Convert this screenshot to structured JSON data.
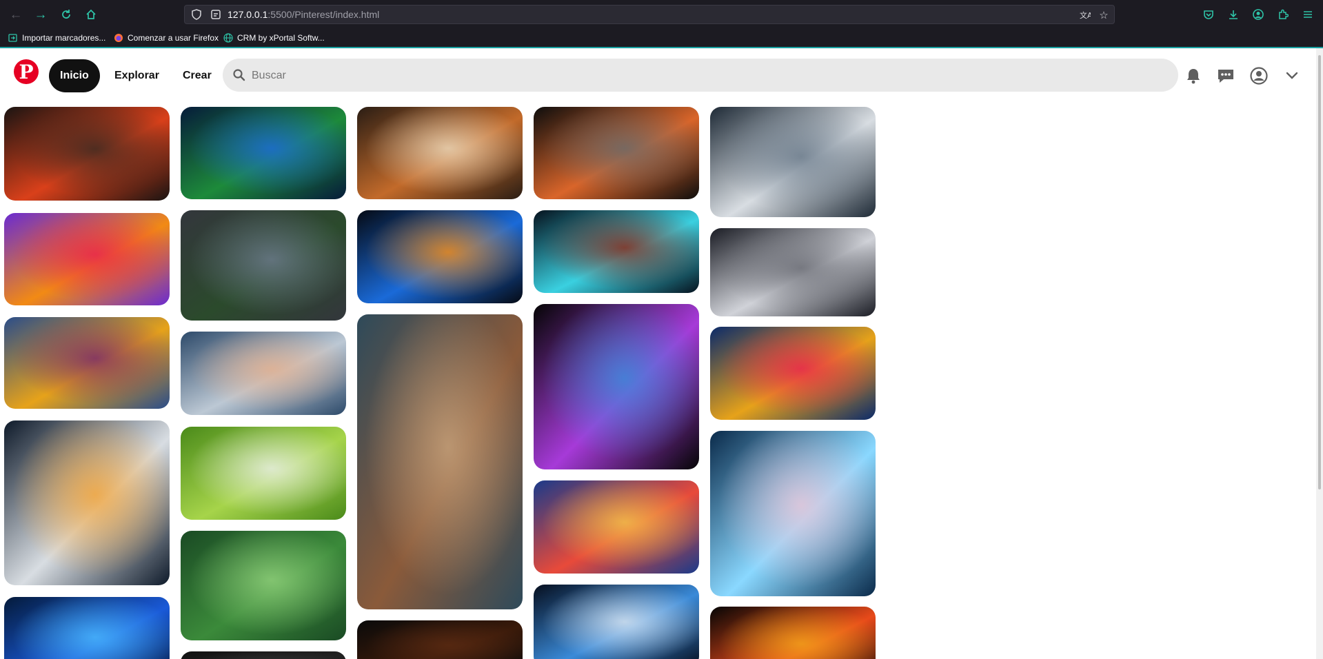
{
  "browser": {
    "url_host": "127.0.0.1",
    "url_path": ":5500/Pinterest/index.html",
    "bookmarks": [
      {
        "label": "Importar marcadores...",
        "icon": "import-icon"
      },
      {
        "label": "Comenzar a usar Firefox",
        "icon": "firefox-icon"
      },
      {
        "label": "CRM by xPortal Softw...",
        "icon": "globe-icon"
      }
    ]
  },
  "header": {
    "logo_letter": "P",
    "nav": {
      "home": "Inicio",
      "explore": "Explorar",
      "create": "Crear"
    },
    "search_placeholder": "Buscar"
  },
  "pins": [
    {
      "subject": "autumn-leaf",
      "colors": [
        "#1a1412",
        "#d9401a",
        "#3a2a22"
      ]
    },
    {
      "subject": "colorful-smoke",
      "colors": [
        "#6a2bd1",
        "#f28a14",
        "#e8234f"
      ]
    },
    {
      "subject": "cat-in-fantasy-forest",
      "colors": [
        "#2a4d8a",
        "#e6a21a",
        "#7a2a6a"
      ]
    },
    {
      "subject": "robot-lightbulb",
      "colors": [
        "#0e1a2a",
        "#d8dde2",
        "#f3a53a"
      ]
    },
    {
      "subject": "blue-lights",
      "colors": [
        "#041a3a",
        "#1a5ad8",
        "#4ab8ff"
      ]
    },
    {
      "subject": "tree-on-circuit-board",
      "colors": [
        "#061b3a",
        "#1d8a3a",
        "#1c6ad8"
      ]
    },
    {
      "subject": "child-and-plant",
      "colors": [
        "#33363c",
        "#2b4a2c",
        "#6b7a8a"
      ]
    },
    {
      "subject": "robot-handshake",
      "colors": [
        "#2d4a6a",
        "#bcc8d4",
        "#e3b08f"
      ]
    },
    {
      "subject": "robot-hand-daisy",
      "colors": [
        "#4a8a1a",
        "#a6d44a",
        "#e8eee4"
      ]
    },
    {
      "subject": "water-drops-leaves",
      "colors": [
        "#1a4a24",
        "#3b8a3a",
        "#8fcf7a"
      ]
    },
    {
      "subject": "dark-pin",
      "colors": [
        "#111111",
        "#222222",
        "#333333"
      ]
    },
    {
      "subject": "cubist-painting",
      "colors": [
        "#2a1d14",
        "#c26a2a",
        "#e9d6b8"
      ]
    },
    {
      "subject": "light-speed-streaks",
      "colors": [
        "#050a14",
        "#1a6ad8",
        "#f28a14"
      ]
    },
    {
      "subject": "surreal-head-collage",
      "colors": [
        "#2e4a5a",
        "#8a5a3a",
        "#c4a07a"
      ]
    },
    {
      "subject": "dark-pin-bottom",
      "colors": [
        "#0a0a0a",
        "#3a1a0a",
        "#5a2a12"
      ]
    },
    {
      "subject": "chip-on-board",
      "colors": [
        "#0d0d0d",
        "#d9652a",
        "#6a6a6a"
      ]
    },
    {
      "subject": "woman-with-screens",
      "colors": [
        "#06121e",
        "#3ad0e0",
        "#8a2a1a"
      ]
    },
    {
      "subject": "book-and-magic",
      "colors": [
        "#050505",
        "#a63ad8",
        "#3a8ad8"
      ]
    },
    {
      "subject": "people-with-phones",
      "colors": [
        "#1a3a8a",
        "#e84a3a",
        "#f2c14a"
      ]
    },
    {
      "subject": "vr-headset-icons",
      "colors": [
        "#060e1e",
        "#3a8ad8",
        "#d8e4f0"
      ]
    },
    {
      "subject": "robot-at-blackboard",
      "colors": [
        "#1e2a36",
        "#d8dde2",
        "#6a7a8a"
      ]
    },
    {
      "subject": "robot-typing",
      "colors": [
        "#1a1c24",
        "#d0d2d8",
        "#6a6c74"
      ]
    },
    {
      "subject": "ai-brain-network",
      "colors": [
        "#0a2a6a",
        "#e6a21a",
        "#e8234f"
      ]
    },
    {
      "subject": "ai-circuit-brain",
      "colors": [
        "#0a2a4a",
        "#8ad8ff",
        "#e8c6d8"
      ]
    },
    {
      "subject": "sunset-planet",
      "colors": [
        "#050505",
        "#e84a1a",
        "#f2a21a"
      ]
    }
  ]
}
